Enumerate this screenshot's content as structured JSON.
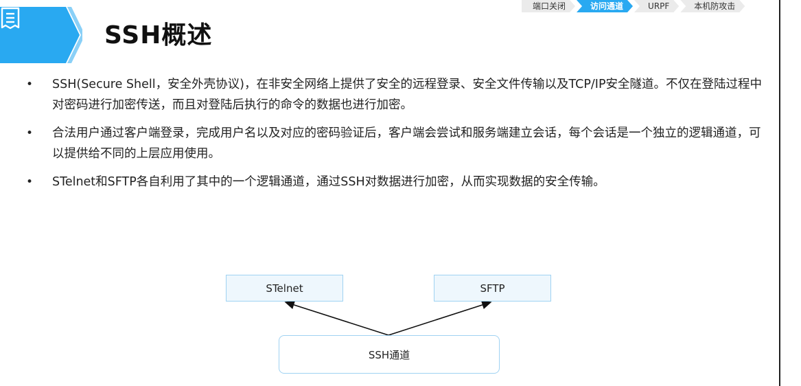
{
  "nav": {
    "items": [
      {
        "label": "端口关闭",
        "active": false
      },
      {
        "label": "访问通道",
        "active": true
      },
      {
        "label": "URPF",
        "active": false
      },
      {
        "label": "本机防攻击",
        "active": false
      }
    ]
  },
  "title": "SSH概述",
  "bullets": [
    "SSH(Secure Shell，安全外壳协议)，在非安全网络上提供了安全的远程登录、安全文件传输以及TCP/IP安全隧道。不仅在登陆过程中对密码进行加密传送，而且对登陆后执行的命令的数据也进行加密。",
    "合法用户通过客户端登录，完成用户名以及对应的密码验证后，客户端会尝试和服务端建立会话，每个会话是一个独立的逻辑通道，可以提供给不同的上层应用使用。",
    "STelnet和SFTP各自利用了其中的一个逻辑通道，通过SSH对数据进行加密，从而实现数据的安全传输。"
  ],
  "diagram": {
    "left_box": "STelnet",
    "right_box": "SFTP",
    "bottom_box": "SSH通道"
  },
  "colors": {
    "accent": "#29a9f1",
    "band_light": "#7ccaf5",
    "box_fill": "#eef7fd",
    "box_border": "#9fd2f2"
  },
  "icons": {
    "title_icon": "document-list-icon",
    "chevron": "chevron-right-icon"
  }
}
